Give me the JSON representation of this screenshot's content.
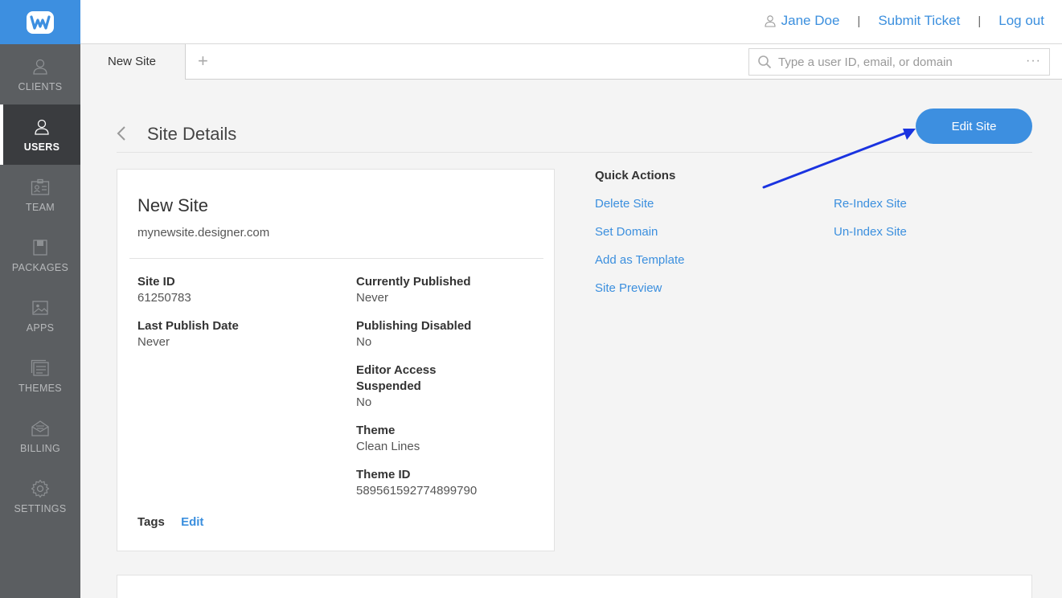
{
  "brand": {
    "logo_letter": "W",
    "accent": "#3d8fe0",
    "sidebar_bg": "#5b5e61"
  },
  "sidebar": {
    "items": [
      {
        "label": "CLIENTS",
        "icon": "person-icon",
        "active": false
      },
      {
        "label": "USERS",
        "icon": "person-icon",
        "active": true
      },
      {
        "label": "TEAM",
        "icon": "id-card-icon",
        "active": false
      },
      {
        "label": "PACKAGES",
        "icon": "package-icon",
        "active": false
      },
      {
        "label": "APPS",
        "icon": "image-icon",
        "active": false
      },
      {
        "label": "THEMES",
        "icon": "themes-icon",
        "active": false
      },
      {
        "label": "BILLING",
        "icon": "envelope-icon",
        "active": false
      },
      {
        "label": "SETTINGS",
        "icon": "gear-icon",
        "active": false
      }
    ]
  },
  "header": {
    "user_name": "Jane Doe",
    "submit_ticket": "Submit Ticket",
    "logout": "Log out",
    "separator": "|"
  },
  "tabs": {
    "active_tab": "New Site",
    "add_tab": "+",
    "search_placeholder": "Type a user ID, email, or domain",
    "search_more": "···"
  },
  "page": {
    "title": "Site Details",
    "edit_button": "Edit Site"
  },
  "site": {
    "name": "New Site",
    "domain": "mynewsite.designer.com",
    "fields": {
      "site_id": {
        "label": "Site ID",
        "value": "61250783"
      },
      "last_publish": {
        "label": "Last Publish Date",
        "value": "Never"
      },
      "currently_published": {
        "label": "Currently Published",
        "value": "Never"
      },
      "publishing_disabled": {
        "label": "Publishing Disabled",
        "value": "No"
      },
      "editor_access": {
        "label": "Editor Access Suspended",
        "value": "No"
      },
      "theme": {
        "label": "Theme",
        "value": "Clean Lines"
      },
      "theme_id": {
        "label": "Theme ID",
        "value": "589561592774899790"
      }
    },
    "tags_label": "Tags",
    "tags_edit": "Edit"
  },
  "quick_actions": {
    "title": "Quick Actions",
    "delete_site": "Delete Site",
    "set_domain": "Set Domain",
    "add_template": "Add as Template",
    "site_preview": "Site Preview",
    "reindex": "Re-Index Site",
    "unindex": "Un-Index Site"
  }
}
